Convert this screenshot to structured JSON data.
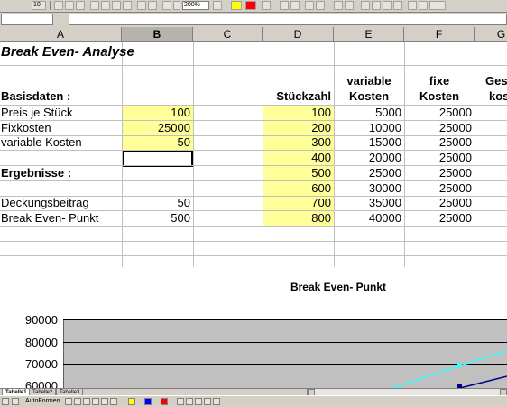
{
  "toolbar": {
    "font_size": "10",
    "zoom": "200%"
  },
  "formula_bar": {
    "name_box": "",
    "content": ""
  },
  "columns": [
    "A",
    "B",
    "C",
    "D",
    "E",
    "F",
    "G"
  ],
  "selected_column": "B",
  "sheet": {
    "title": "Break Even- Analyse",
    "basisdaten_label": "Basisdaten :",
    "preis_label": "Preis je Stück",
    "preis_value": "100",
    "fixkosten_label": "Fixkosten",
    "fixkosten_value": "25000",
    "variable_label": "variable Kosten",
    "variable_value": "50",
    "ergebnisse_label": "Ergebnisse :",
    "deckung_label": "Deckungsbeitrag",
    "deckung_value": "50",
    "break_even_label": "Break Even- Punkt",
    "break_even_value": "500",
    "hdr_stueck": "Stückzahl",
    "hdr_variable_1": "variable",
    "hdr_variable_2": "Kosten",
    "hdr_fixe_1": "fixe",
    "hdr_fixe_2": "Kosten",
    "hdr_ges_1": "Ges",
    "hdr_ges_2": "kos"
  },
  "table_rows": [
    {
      "stueck": "100",
      "variable": "5000",
      "fixe": "25000"
    },
    {
      "stueck": "200",
      "variable": "10000",
      "fixe": "25000"
    },
    {
      "stueck": "300",
      "variable": "15000",
      "fixe": "25000"
    },
    {
      "stueck": "400",
      "variable": "20000",
      "fixe": "25000"
    },
    {
      "stueck": "500",
      "variable": "25000",
      "fixe": "25000"
    },
    {
      "stueck": "600",
      "variable": "30000",
      "fixe": "25000"
    },
    {
      "stueck": "700",
      "variable": "35000",
      "fixe": "25000"
    },
    {
      "stueck": "800",
      "variable": "40000",
      "fixe": "25000"
    }
  ],
  "chart": {
    "title": "Break Even- Punkt",
    "y_ticks": [
      "90000",
      "80000",
      "70000",
      "60000"
    ],
    "plot_color": "#c0c0c0",
    "line1_color": "#33ffff",
    "line2_color": "#000080"
  },
  "tabs": [
    "Tabelle1",
    "Tabelle2",
    "Tabelle3"
  ],
  "drawbar": {
    "autoformen": "AutoFormen"
  }
}
